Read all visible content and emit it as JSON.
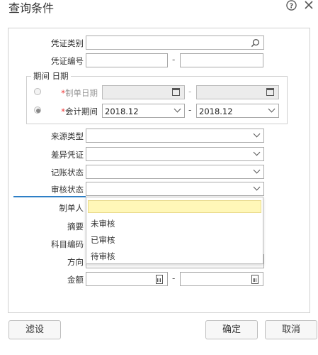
{
  "dialog": {
    "title": "查询条件",
    "help_icon": "question-circle-icon",
    "close_icon": "close-icon"
  },
  "fields": {
    "voucher_type_label": "凭证类别",
    "voucher_no_label": "凭证编号",
    "period_group_label": "期间 日期",
    "make_date_label": "制单日期",
    "accounting_period_label": "会计期间",
    "period_from": "2018.12",
    "period_to": "2018.12",
    "source_type_label": "来源类型",
    "diff_voucher_label": "差异凭证",
    "posting_status_label": "记账状态",
    "audit_status_label": "审核状态",
    "maker_label": "制单人",
    "summary_label": "摘要",
    "account_code_label": "科目编码",
    "direction_label": "方向",
    "amount_label": "金额",
    "range_sep": "-",
    "required_mark": "*"
  },
  "dropdown": {
    "options": [
      "",
      "未审核",
      "已审核",
      "待审核"
    ]
  },
  "buttons": {
    "filter": "滤设",
    "ok": "确定",
    "cancel": "取消"
  },
  "colors": {
    "highlight": "#fff7b8",
    "accent": "#2e7fc6",
    "required": "#e33333"
  }
}
